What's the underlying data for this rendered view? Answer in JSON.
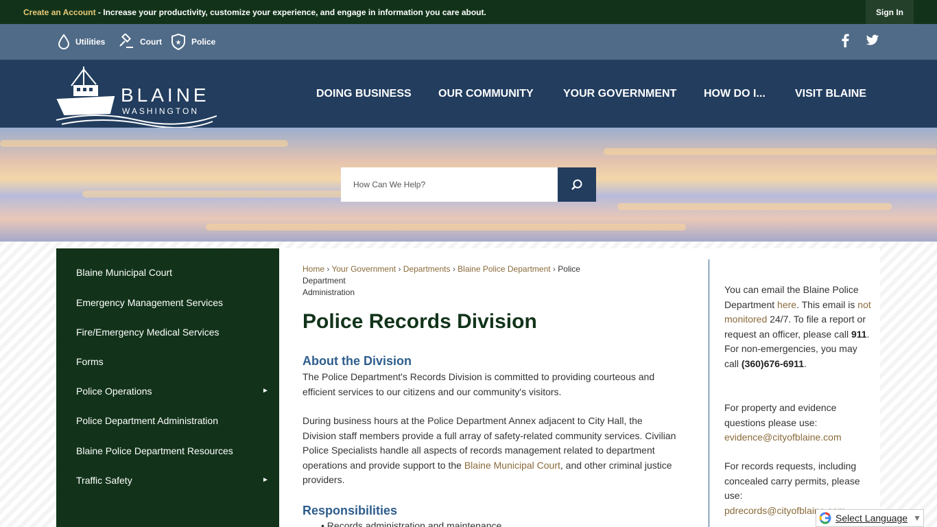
{
  "topbar": {
    "create_account": "Create an Account",
    "message": " - Increase your productivity, customize your experience, and engage in information you care about.",
    "sign_in": "Sign In"
  },
  "quick_links": [
    {
      "label": "Utilities",
      "icon": "water-drop-icon"
    },
    {
      "label": "Court",
      "icon": "gavel-icon"
    },
    {
      "label": "Police",
      "icon": "police-badge-icon"
    }
  ],
  "social": {
    "facebook": "facebook-icon",
    "twitter": "twitter-icon"
  },
  "logo": {
    "line1": "BLAINE",
    "line2": "WASHINGTON"
  },
  "nav": [
    "DOING BUSINESS",
    "OUR COMMUNITY",
    "YOUR GOVERNMENT",
    "HOW DO I...",
    "VISIT BLAINE"
  ],
  "search": {
    "placeholder": "How Can We Help?"
  },
  "sidebar": {
    "items": [
      {
        "label": "Blaine Municipal Court",
        "has_submenu": false
      },
      {
        "label": "Emergency Management Services",
        "has_submenu": false
      },
      {
        "label": "Fire/Emergency Medical Services",
        "has_submenu": false
      },
      {
        "label": "Forms",
        "has_submenu": false
      },
      {
        "label": "Police Operations",
        "has_submenu": true
      },
      {
        "label": "Police Department Administration",
        "has_submenu": false
      },
      {
        "label": "Blaine Police Department Resources",
        "has_submenu": false
      },
      {
        "label": "Traffic Safety",
        "has_submenu": true
      }
    ],
    "arrow": "►"
  },
  "breadcrumb": {
    "items": [
      "Home",
      "Your Government",
      "Departments",
      "Blaine Police Department"
    ],
    "current_line1": "Police Department",
    "current_line2": "Administration",
    "separator": "›"
  },
  "page": {
    "title": "Police Records Division",
    "section1_heading": "About the Division",
    "para1": "The Police Department's Records Division is committed to providing courteous and efficient services to our citizens and our community's visitors.",
    "para2_before": "During business hours at the Police Department Annex adjacent to City Hall, the Division staff members provide a full array of safety-related community services.  Civilian Police Specialists handle all aspects of records management related to department operations and provide support to the ",
    "para2_link": "Blaine Municipal Court",
    "para2_after": ", and other criminal justice providers.",
    "section2_heading": "Responsibilities",
    "bullet1": "Records administration and maintenance"
  },
  "right_column": {
    "p1_a": "You can email the Blaine Police Department ",
    "p1_link1": "here",
    "p1_b": ".  This email is ",
    "p1_link2": "not monitored",
    "p1_c": " 24/7. To file a report or request an officer, please call ",
    "p1_911": "911",
    "p1_d": ".  For non-emergencies, you may call ",
    "p1_phone": "(360)676-6911",
    "p1_e": ".",
    "p2_text": "For property and evidence questions please use:",
    "p2_email": "evidence@cityofblaine.com",
    "p3_text": "For records requests, including concealed carry permits, please use:",
    "p3_email": "pdrecords@cityofblaine.com"
  },
  "translate": {
    "label": "Select Language",
    "arrow": "▼"
  },
  "colors": {
    "topbar_bg": "#12331a",
    "quickbar_bg": "#506b88",
    "header_bg": "#223d5e",
    "sidebar_bg": "#12331a",
    "link_color": "#8a6a3a",
    "heading_blue": "#2e5d8c",
    "create_account_gold": "#e8c977"
  }
}
